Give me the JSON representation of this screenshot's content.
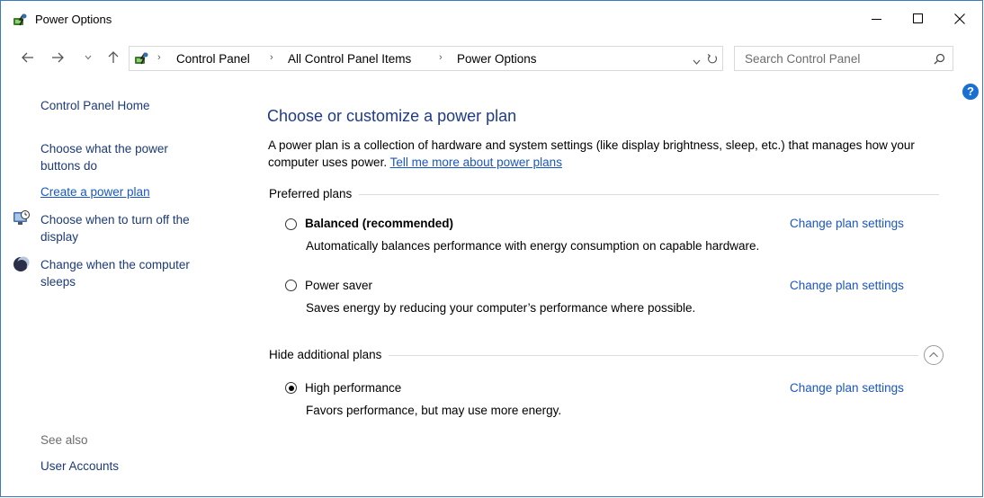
{
  "window": {
    "title": "Power Options"
  },
  "address": {
    "crumbs": [
      "Control Panel",
      "All Control Panel Items",
      "Power Options"
    ]
  },
  "search": {
    "placeholder": "Search Control Panel"
  },
  "leftnav": {
    "home": "Control Panel Home",
    "buttons": "Choose what the power buttons do",
    "create_plan": "Create a power plan",
    "turn_off_display": "Choose when to turn off the display",
    "sleep": "Change when the computer sleeps",
    "see_also_label": "See also",
    "user_accounts": "User Accounts"
  },
  "main": {
    "title": "Choose or customize a power plan",
    "intro": "A power plan is a collection of hardware and system settings (like display brightness, sleep, etc.) that manages how your computer uses power.",
    "intro_link": "Tell me more about power plans",
    "preferred_label": "Preferred plans",
    "additional_label": "Hide additional plans",
    "change_label": "Change plan settings",
    "plans": [
      {
        "name": "Balanced (recommended)",
        "desc": "Automatically balances performance with energy consumption on capable hardware.",
        "selected": false
      },
      {
        "name": "Power saver",
        "desc": "Saves energy by reducing your computer’s performance where possible.",
        "selected": false
      },
      {
        "name": "High performance",
        "desc": "Favors performance, but may use more energy.",
        "selected": true
      }
    ]
  },
  "colors": {
    "link": "#1a56c0",
    "nav_link": "#1c3a78",
    "title": "#1e3a8c",
    "window_border": "#3b7bbf"
  },
  "icons": [
    "power-options-icon",
    "back-arrow-icon",
    "forward-arrow-icon",
    "recent-dropdown-icon",
    "up-arrow-icon",
    "refresh-icon",
    "search-icon",
    "help-icon",
    "display-clock-icon",
    "moon-sleep-icon",
    "collapse-chevron-icon",
    "minimize-icon",
    "maximize-icon",
    "close-icon"
  ]
}
